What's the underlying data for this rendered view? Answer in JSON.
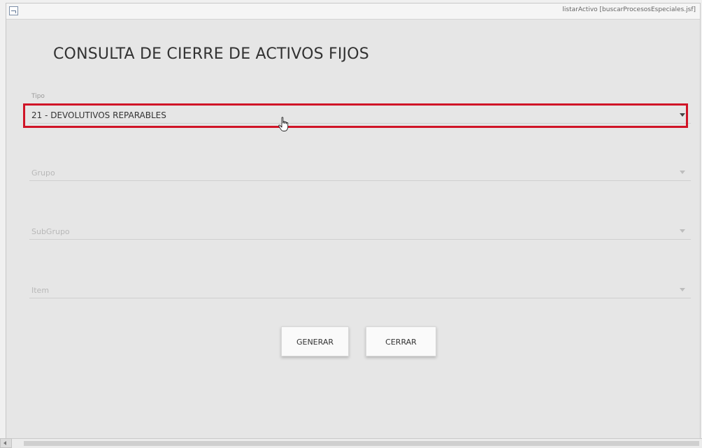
{
  "window": {
    "title": "listarActivo [buscarProcesosEspeciales.jsf]"
  },
  "page": {
    "title": "CONSULTA DE CIERRE DE ACTIVOS FIJOS"
  },
  "form": {
    "tipo": {
      "label": "Tipo",
      "value": "21 - DEVOLUTIVOS REPARABLES"
    },
    "grupo": {
      "placeholder": "Grupo"
    },
    "subgrupo": {
      "placeholder": "SubGrupo"
    },
    "item": {
      "placeholder": "Item"
    }
  },
  "buttons": {
    "generar": "GENERAR",
    "cerrar": "CERRAR"
  },
  "colors": {
    "highlight": "#d01427",
    "background": "#e6e6e6"
  },
  "icons": {
    "cursor": "hand-pointer-icon",
    "dropdown": "triangle-down-icon",
    "window": "window-app-icon"
  }
}
